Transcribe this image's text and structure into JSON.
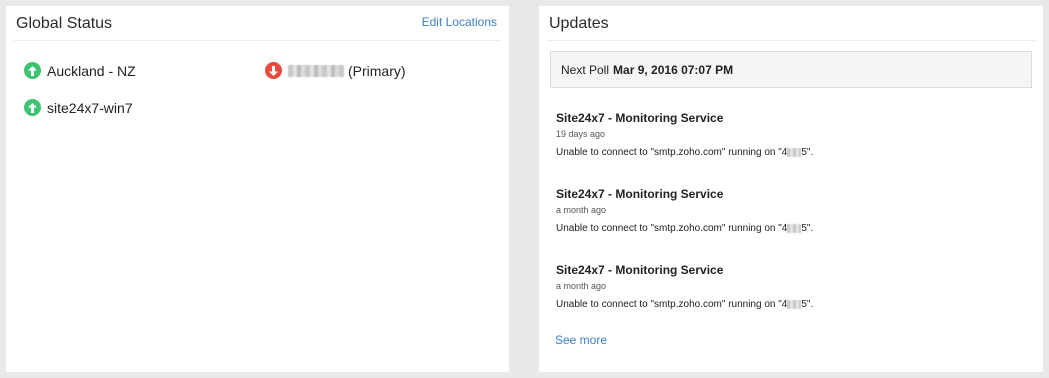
{
  "global_status": {
    "title": "Global Status",
    "edit_label": "Edit Locations",
    "locations": [
      {
        "name": "Auckland - NZ",
        "status": "up"
      },
      {
        "name": "(Primary)",
        "status": "down"
      },
      {
        "name": "site24x7-win7",
        "status": "up"
      }
    ]
  },
  "updates": {
    "title": "Updates",
    "poll_label": "Next Poll",
    "poll_value": "Mar 9, 2016 07:07 PM",
    "items": [
      {
        "title": "Site24x7 - Monitoring Service",
        "time": "19 days ago",
        "msg_prefix": "Unable to connect to \"smtp.zoho.com\" running on \"4",
        "msg_suffix": "5\"."
      },
      {
        "title": "Site24x7 - Monitoring Service",
        "time": "a month ago",
        "msg_prefix": "Unable to connect to \"smtp.zoho.com\" running on \"4",
        "msg_suffix": "5\"."
      },
      {
        "title": "Site24x7 - Monitoring Service",
        "time": "a month ago",
        "msg_prefix": "Unable to connect to \"smtp.zoho.com\" running on \"4",
        "msg_suffix": "5\"."
      }
    ],
    "see_more_label": "See more"
  },
  "colors": {
    "up": "#3cc472",
    "down": "#e74c3c",
    "link": "#3b7fc4"
  }
}
